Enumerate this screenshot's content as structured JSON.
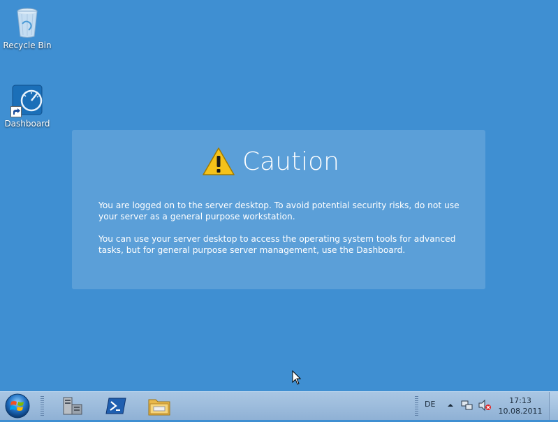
{
  "desktop": {
    "icons": [
      {
        "label": "Recycle Bin",
        "icon": "recycle-bin-icon"
      },
      {
        "label": "Dashboard",
        "icon": "dashboard-icon"
      }
    ]
  },
  "banner": {
    "title": "Caution",
    "paragraph1": "You are logged on to the server desktop. To avoid potential security risks, do not use your server as a general purpose workstation.",
    "paragraph2": "You can use your server desktop to access the operating system tools for advanced tasks, but for general purpose server management, use the Dashboard."
  },
  "taskbar": {
    "pinned": [
      "server-manager-icon",
      "powershell-icon",
      "explorer-folder-icon"
    ],
    "language": "DE",
    "time": "17:13",
    "date": "10.08.2011"
  },
  "colors": {
    "desktop": "#3f8fd2",
    "taskbar": "#9dbcdc"
  }
}
